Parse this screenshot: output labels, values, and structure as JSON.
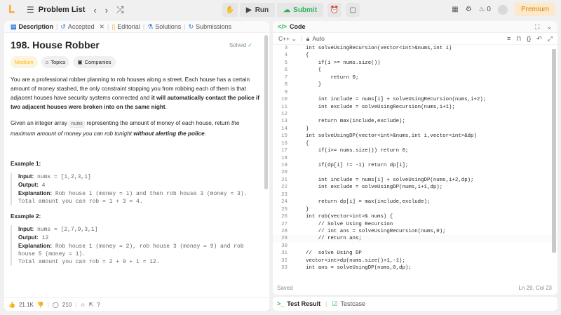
{
  "topbar": {
    "problem_list": "Problem List",
    "run": "Run",
    "submit": "Submit",
    "streak": "0",
    "premium": "Premium"
  },
  "left_tabs": [
    {
      "label": "Description",
      "icon": "description-icon"
    },
    {
      "label": "Accepted",
      "icon": "history-icon"
    },
    {
      "label": "Editorial",
      "icon": "editorial-icon"
    },
    {
      "label": "Solutions",
      "icon": "flask-icon"
    },
    {
      "label": "Submissions",
      "icon": "submissions-icon"
    }
  ],
  "problem": {
    "title": "198. House Robber",
    "status": "Solved",
    "difficulty": "Medium",
    "topics": "Topics",
    "companies": "Companies",
    "p1_a": "You are a professional robber planning to rob houses along a street. Each house has a certain amount of money stashed, the only constraint stopping you from robbing each of them is that adjacent houses have security systems connected and ",
    "p1_b": "it will automatically contact the police if two adjacent houses were broken into on the same night",
    "p1_c": ".",
    "p2_a": "Given an integer array ",
    "p2_code": "nums",
    "p2_b": " representing the amount of money of each house, return ",
    "p2_c": "the maximum amount of money you can rob tonight ",
    "p2_d": "without alerting the police",
    "p2_e": ".",
    "examples": [
      {
        "title": "Example 1:",
        "input_label": "Input:",
        "input": " nums = [1,2,3,1]",
        "output_label": "Output:",
        "output": " 4",
        "explanation_label": "Explanation:",
        "explanation": " Rob house 1 (money = 1) and then rob house 3 (money = 3).",
        "total": "Total amount you can rob = 1 + 3 = 4."
      },
      {
        "title": "Example 2:",
        "input_label": "Input:",
        "input": " nums = [2,7,9,3,1]",
        "output_label": "Output:",
        "output": " 12",
        "explanation_label": "Explanation:",
        "explanation": " Rob house 1 (money = 2), rob house 3 (money = 9) and rob house 5 (money = 1).",
        "total": "Total amount you can rob = 2 + 9 + 1 = 12."
      }
    ],
    "likes": "21.1K",
    "comments": "210"
  },
  "code_panel": {
    "title": "Code",
    "language": "C++",
    "mode": "Auto",
    "saved": "Saved",
    "cursor": "Ln 29, Col 23",
    "lines": [
      {
        "n": "3",
        "t": "int solveUsingRecursion(vector<int>&nums,int i)"
      },
      {
        "n": "4",
        "t": "{"
      },
      {
        "n": "5",
        "t": "    if(i >= nums.size())"
      },
      {
        "n": "6",
        "t": "    {"
      },
      {
        "n": "7",
        "t": "        return 0;"
      },
      {
        "n": "8",
        "t": "    }"
      },
      {
        "n": "9",
        "t": ""
      },
      {
        "n": "10",
        "t": "    int include = nums[i] + solveUsingRecursion(nums,i+2);"
      },
      {
        "n": "11",
        "t": "    int exclude = solveUsingRecursion(nums,i+1);"
      },
      {
        "n": "12",
        "t": ""
      },
      {
        "n": "13",
        "t": "    return max(include,exclude);"
      },
      {
        "n": "14",
        "t": "}"
      },
      {
        "n": "15",
        "t": "int solveUsingDP(vector<int>&nums,int i,vector<int>&dp)"
      },
      {
        "n": "16",
        "t": "{"
      },
      {
        "n": "17",
        "t": "    if(i>= nums.size()) return 0;"
      },
      {
        "n": "18",
        "t": ""
      },
      {
        "n": "19",
        "t": "    if(dp[i] != -1) return dp[i];"
      },
      {
        "n": "20",
        "t": ""
      },
      {
        "n": "21",
        "t": "    int include = nums[i] + solveUsingDP(nums,i+2,dp);"
      },
      {
        "n": "22",
        "t": "    int exclude = solveUsingDP(nums,i+1,dp);"
      },
      {
        "n": "23",
        "t": ""
      },
      {
        "n": "24",
        "t": "    return dp[i] = max(include,exclude);"
      },
      {
        "n": "25",
        "t": "}"
      },
      {
        "n": "26",
        "t": "int rob(vector<int>& nums) {"
      },
      {
        "n": "27",
        "t": "    // Solve Using Recursion"
      },
      {
        "n": "28",
        "t": "    // int ans = solveUsingRecursion(nums,0);"
      },
      {
        "n": "29",
        "t": "    // return ans;"
      },
      {
        "n": "30",
        "t": ""
      },
      {
        "n": "31",
        "t": "//  solve Using DP"
      },
      {
        "n": "32",
        "t": "vector<int>dp(nums.size()+1,-1);"
      },
      {
        "n": "33",
        "t": "int ans = solveUsingDP(nums,0,dp);"
      }
    ]
  },
  "bottom_panel": {
    "test_result": "Test Result",
    "testcase": "Testcase"
  },
  "colors": {
    "accent_orange": "#ffa116",
    "accent_green": "#2db55d",
    "difficulty_medium": "#ffb800"
  }
}
